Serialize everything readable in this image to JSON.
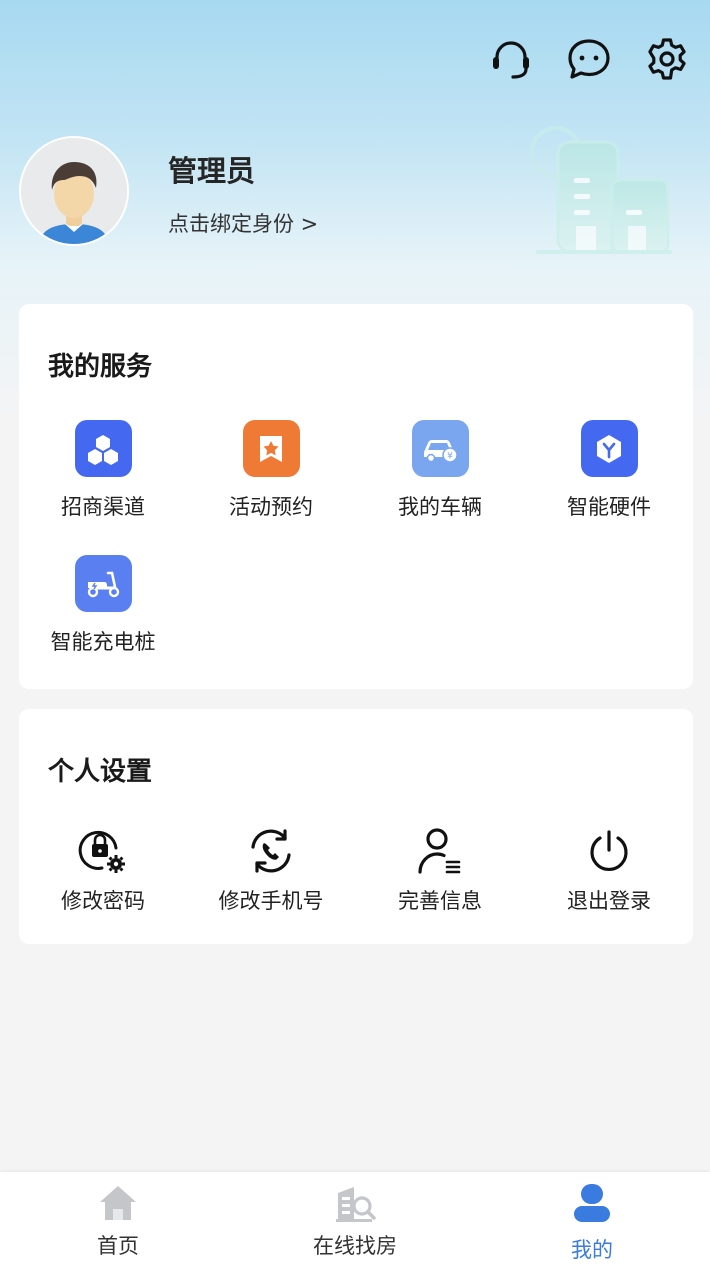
{
  "header": {
    "icons": [
      "headset-icon",
      "chat-icon",
      "settings-gear-icon"
    ]
  },
  "profile": {
    "name": "管理员",
    "bind_identity": "点击绑定身份 >"
  },
  "services": {
    "title": "我的服务",
    "items": [
      {
        "label": "招商渠道",
        "icon": "cubes-icon",
        "color": "#4469f0"
      },
      {
        "label": "活动预约",
        "icon": "star-bookmark-icon",
        "color": "#ee7a36"
      },
      {
        "label": "我的车辆",
        "icon": "car-icon",
        "color": "#7aa6ef"
      },
      {
        "label": "智能硬件",
        "icon": "hardware-box-icon",
        "color": "#4469f0"
      },
      {
        "label": "智能充电桩",
        "icon": "scooter-icon",
        "color": "#5a7ff0"
      }
    ]
  },
  "settings": {
    "title": "个人设置",
    "items": [
      {
        "label": "修改密码",
        "icon": "lock-gear-icon"
      },
      {
        "label": "修改手机号",
        "icon": "phone-refresh-icon"
      },
      {
        "label": "完善信息",
        "icon": "user-info-icon"
      },
      {
        "label": "退出登录",
        "icon": "power-icon"
      }
    ]
  },
  "tabbar": {
    "tabs": [
      {
        "label": "首页",
        "icon": "home-icon",
        "active": false
      },
      {
        "label": "在线找房",
        "icon": "building-search-icon",
        "active": false
      },
      {
        "label": "我的",
        "icon": "user-icon",
        "active": true
      }
    ],
    "active_color": "#3a7be0"
  }
}
